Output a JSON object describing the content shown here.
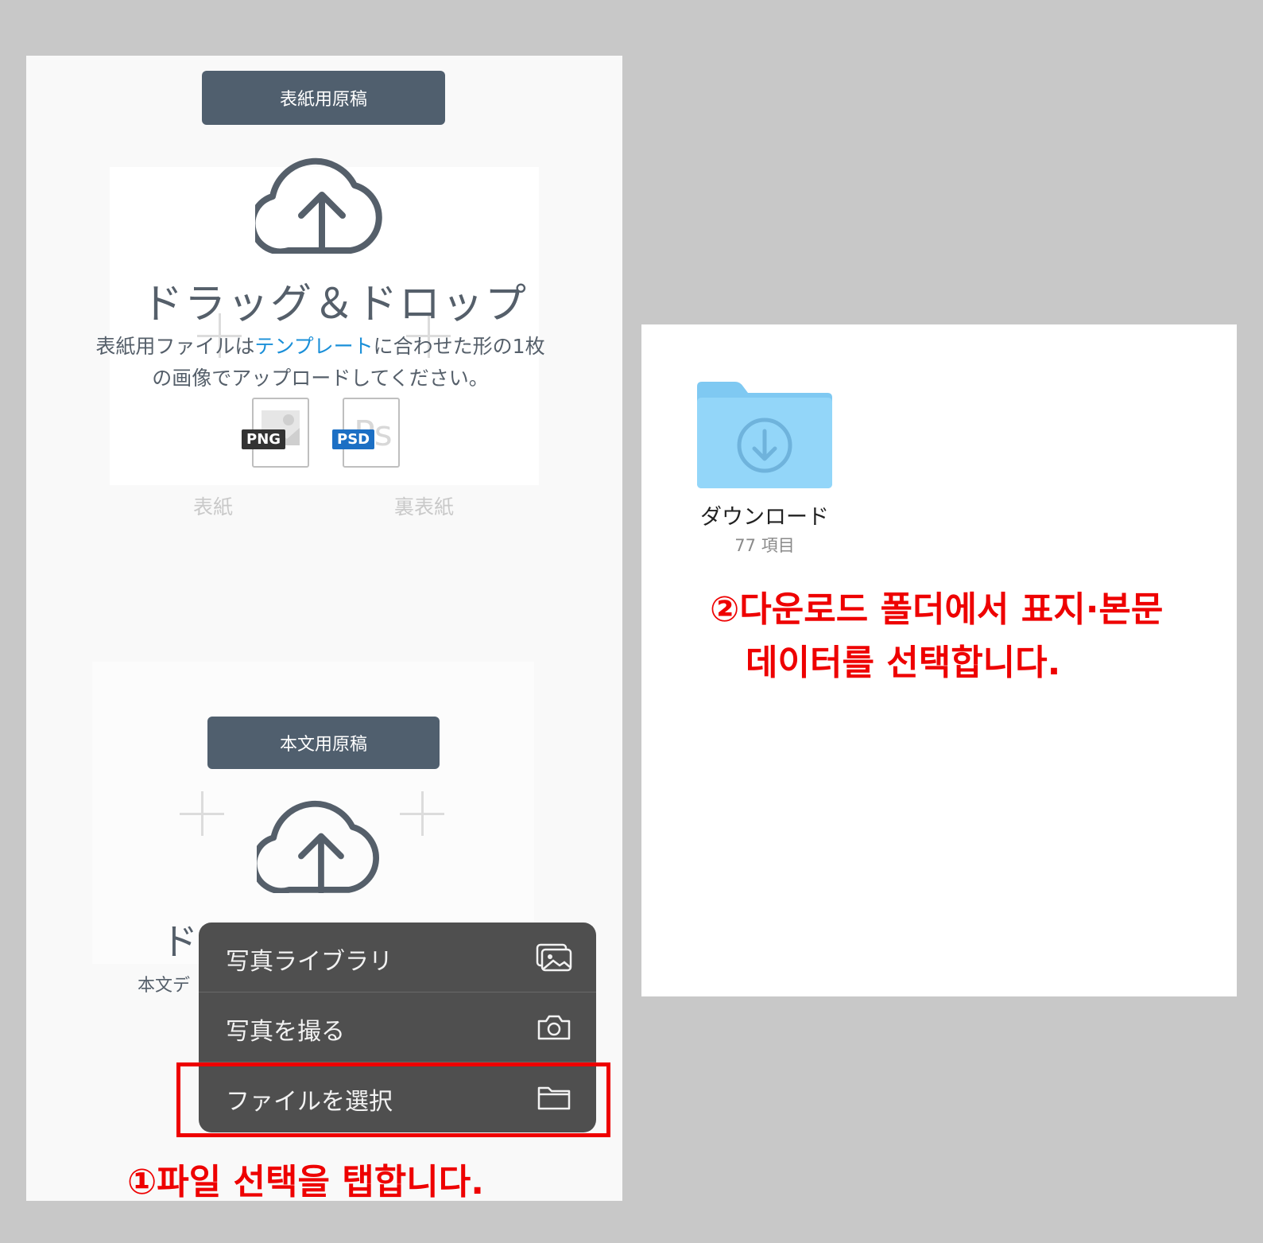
{
  "left": {
    "cover_button": "表紙用原稿",
    "drag_drop_title": "ドラッグ＆ドロップ",
    "cover_desc_part1": "表紙用ファイルは",
    "cover_desc_link": "テンプレート",
    "cover_desc_part2": "に合わせた形の1枚",
    "cover_desc_line2": "の画像でアップロードしてください。",
    "badge_png": "PNG",
    "badge_psd": "PSD",
    "ghost_front": "表紙",
    "ghost_back": "裏表紙",
    "body_button": "本文用原稿",
    "partial_title": "ド",
    "partial_desc": "本文デ"
  },
  "menu": {
    "items": [
      {
        "label": "写真ライブラリ",
        "icon": "photo-library-icon"
      },
      {
        "label": "写真を撮る",
        "icon": "camera-icon"
      },
      {
        "label": "ファイルを選択",
        "icon": "folder-icon"
      }
    ]
  },
  "right": {
    "folder_name": "ダウンロード",
    "folder_count": "77 項目"
  },
  "annotations": {
    "step1": "①파일 선택을 탭합니다.",
    "step2_line1": "②다운로드 폴더에서 표지·본문",
    "step2_line2": "데이터를 선택합니다."
  },
  "colors": {
    "background": "#c8c8c8",
    "button": "#505f6e",
    "link": "#1a8fd8",
    "annotation_red": "#ee0000",
    "menu_bg": "#4f4f4f",
    "folder_blue": "#8fd0f5"
  }
}
